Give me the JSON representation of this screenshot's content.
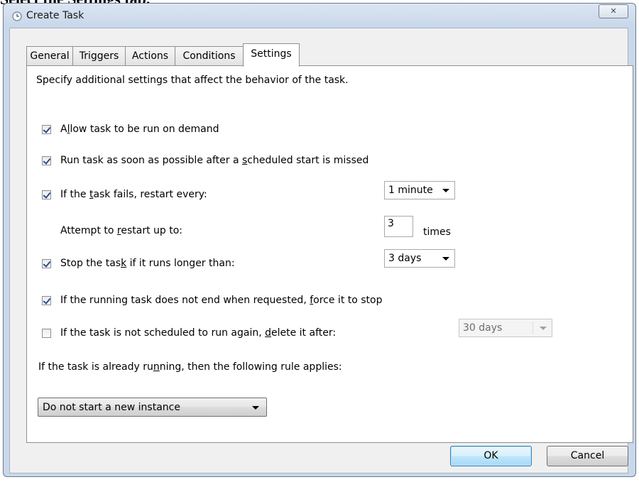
{
  "caption": "Select the Settings tab.",
  "window": {
    "title": "Create Task",
    "icon": "clock-icon",
    "close_glyph": "✕"
  },
  "tabs": [
    {
      "label": "General",
      "active": false
    },
    {
      "label": "Triggers",
      "active": false
    },
    {
      "label": "Actions",
      "active": false
    },
    {
      "label": "Conditions",
      "active": false
    },
    {
      "label": "Settings",
      "active": true
    }
  ],
  "settings": {
    "description": "Specify additional settings that affect the behavior of the task.",
    "allow_on_demand": {
      "pre": "A",
      "u": "l",
      "post": "low task to be run on demand",
      "checked": true
    },
    "run_missed": {
      "pre": "Run task as soon as possible after a ",
      "u": "s",
      "post": "cheduled start is missed",
      "checked": true
    },
    "restart_on_fail": {
      "pre": "If the ",
      "u": "t",
      "post": "ask fails, restart every:",
      "checked": true,
      "interval": "1 minute"
    },
    "restart_attempts": {
      "pre": "Attempt to ",
      "u": "r",
      "post": "estart up to:",
      "value": "3",
      "unit": "times"
    },
    "stop_if_longer": {
      "pre": "Stop the tas",
      "u": "k",
      "post": " if it runs longer than:",
      "checked": true,
      "duration": "3 days"
    },
    "force_stop": {
      "pre": "If the running task does not end when requested, ",
      "u": "f",
      "post": "orce it to stop",
      "checked": true
    },
    "delete_after": {
      "pre": "If the task is not scheduled to run again, ",
      "u": "d",
      "post": "elete it after:",
      "checked": false,
      "duration": "30 days"
    },
    "running_rule": {
      "pre": "If the task is already ru",
      "u": "n",
      "post": "ning, then the following rule applies:"
    },
    "instance_rule": "Do not start a new instance"
  },
  "buttons": {
    "ok": "OK",
    "cancel": "Cancel"
  }
}
